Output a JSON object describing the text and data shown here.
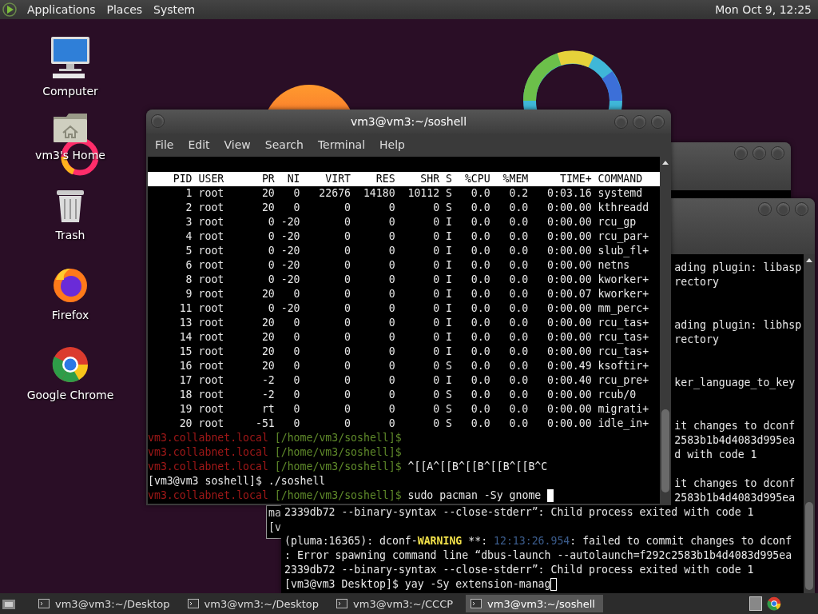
{
  "top_panel": {
    "menus": [
      {
        "label": "Applications"
      },
      {
        "label": "Places"
      },
      {
        "label": "System"
      }
    ],
    "clock": "Mon Oct 9, 12:25"
  },
  "desktop_icons": [
    {
      "kind": "computer",
      "label": "Computer"
    },
    {
      "kind": "home",
      "label": "vm3's Home"
    },
    {
      "kind": "trash",
      "label": "Trash"
    },
    {
      "kind": "firefox",
      "label": "Firefox"
    },
    {
      "kind": "chrome",
      "label": "Google Chrome"
    }
  ],
  "back_window_small": {
    "lines": [
      "ma",
      "[v"
    ]
  },
  "back_terminal": {
    "lines": [
      {
        "kind": "partial",
        "segments": [
          {
            "kind": "text",
            "text": "ading plugin: libasp"
          }
        ]
      },
      {
        "kind": "partial",
        "segments": [
          {
            "kind": "text",
            "text": "rectory"
          }
        ]
      },
      {
        "kind": "blank"
      },
      {
        "kind": "blank"
      },
      {
        "kind": "partial",
        "segments": [
          {
            "kind": "text",
            "text": "ading plugin: libhsp"
          }
        ]
      },
      {
        "kind": "partial",
        "segments": [
          {
            "kind": "text",
            "text": "rectory"
          }
        ]
      },
      {
        "kind": "blank"
      },
      {
        "kind": "blank"
      },
      {
        "kind": "partial",
        "segments": [
          {
            "kind": "text",
            "text": "ker_language_to_key"
          }
        ]
      },
      {
        "kind": "blank"
      },
      {
        "kind": "blank"
      },
      {
        "kind": "partial",
        "segments": [
          {
            "kind": "text",
            "text": "it changes to dconf"
          }
        ]
      },
      {
        "kind": "partial",
        "segments": [
          {
            "kind": "text",
            "text": "2583b1b4d4083d995ea"
          }
        ]
      },
      {
        "kind": "partial",
        "segments": [
          {
            "kind": "text",
            "text": "d with code 1"
          }
        ]
      },
      {
        "kind": "blank"
      },
      {
        "kind": "partial",
        "segments": [
          {
            "kind": "text",
            "text": "it changes to dconf"
          }
        ]
      },
      {
        "kind": "partial",
        "segments": [
          {
            "kind": "text",
            "text": "2583b1b4d4083d995ea"
          }
        ]
      },
      {
        "kind": "full",
        "segments": [
          {
            "kind": "text",
            "text": "2339db72 --binary-syntax --close-stderr”: Child process exited with code 1"
          }
        ]
      },
      {
        "kind": "blank"
      },
      {
        "kind": "full",
        "segments": [
          {
            "kind": "text",
            "text": "(pluma:16365): dconf-"
          },
          {
            "kind": "warning",
            "text": "WARNING"
          },
          {
            "kind": "text",
            "text": " **: "
          },
          {
            "kind": "time",
            "text": "12:13:26.954"
          },
          {
            "kind": "text",
            "text": ": failed to commit changes to dconf"
          }
        ]
      },
      {
        "kind": "full",
        "segments": [
          {
            "kind": "text",
            "text": ": Error spawning command line “dbus-launch --autolaunch=f292c2583b1b4d4083d995ea"
          }
        ]
      },
      {
        "kind": "full",
        "segments": [
          {
            "kind": "text",
            "text": "2339db72 --binary-syntax --close-stderr”: Child process exited with code 1"
          }
        ]
      },
      {
        "kind": "full",
        "segments": [
          {
            "kind": "text",
            "text": "[vm3@vm3 Desktop]$ yay -Sy extension-manag"
          }
        ],
        "cursor": true,
        "focused": false
      }
    ]
  },
  "terminal": {
    "title": "vm3@vm3:~/soshell",
    "menu": [
      {
        "label": "File"
      },
      {
        "label": "Edit"
      },
      {
        "label": "View"
      },
      {
        "label": "Search"
      },
      {
        "label": "Terminal"
      },
      {
        "label": "Help"
      }
    ],
    "top": {
      "columns": [
        "PID",
        "USER",
        "PR",
        "NI",
        "VIRT",
        "RES",
        "SHR",
        "S",
        "%CPU",
        "%MEM",
        "TIME+",
        "COMMAND"
      ],
      "rows": [
        [
          "1",
          "root",
          "20",
          "0",
          "22676",
          "14180",
          "10112",
          "S",
          "0.0",
          "0.2",
          "0:03.16",
          "systemd"
        ],
        [
          "2",
          "root",
          "20",
          "0",
          "0",
          "0",
          "0",
          "S",
          "0.0",
          "0.0",
          "0:00.00",
          "kthreadd"
        ],
        [
          "3",
          "root",
          "0",
          "-20",
          "0",
          "0",
          "0",
          "I",
          "0.0",
          "0.0",
          "0:00.00",
          "rcu_gp"
        ],
        [
          "4",
          "root",
          "0",
          "-20",
          "0",
          "0",
          "0",
          "I",
          "0.0",
          "0.0",
          "0:00.00",
          "rcu_par+"
        ],
        [
          "5",
          "root",
          "0",
          "-20",
          "0",
          "0",
          "0",
          "I",
          "0.0",
          "0.0",
          "0:00.00",
          "slub_fl+"
        ],
        [
          "6",
          "root",
          "0",
          "-20",
          "0",
          "0",
          "0",
          "I",
          "0.0",
          "0.0",
          "0:00.00",
          "netns"
        ],
        [
          "8",
          "root",
          "0",
          "-20",
          "0",
          "0",
          "0",
          "I",
          "0.0",
          "0.0",
          "0:00.00",
          "kworker+"
        ],
        [
          "9",
          "root",
          "20",
          "0",
          "0",
          "0",
          "0",
          "I",
          "0.0",
          "0.0",
          "0:00.07",
          "kworker+"
        ],
        [
          "11",
          "root",
          "0",
          "-20",
          "0",
          "0",
          "0",
          "I",
          "0.0",
          "0.0",
          "0:00.00",
          "mm_perc+"
        ],
        [
          "13",
          "root",
          "20",
          "0",
          "0",
          "0",
          "0",
          "I",
          "0.0",
          "0.0",
          "0:00.00",
          "rcu_tas+"
        ],
        [
          "14",
          "root",
          "20",
          "0",
          "0",
          "0",
          "0",
          "I",
          "0.0",
          "0.0",
          "0:00.00",
          "rcu_tas+"
        ],
        [
          "15",
          "root",
          "20",
          "0",
          "0",
          "0",
          "0",
          "I",
          "0.0",
          "0.0",
          "0:00.00",
          "rcu_tas+"
        ],
        [
          "16",
          "root",
          "20",
          "0",
          "0",
          "0",
          "0",
          "S",
          "0.0",
          "0.0",
          "0:00.49",
          "ksoftir+"
        ],
        [
          "17",
          "root",
          "-2",
          "0",
          "0",
          "0",
          "0",
          "I",
          "0.0",
          "0.0",
          "0:00.40",
          "rcu_pre+"
        ],
        [
          "18",
          "root",
          "-2",
          "0",
          "0",
          "0",
          "0",
          "S",
          "0.0",
          "0.0",
          "0:00.00",
          "rcub/0"
        ],
        [
          "19",
          "root",
          "rt",
          "0",
          "0",
          "0",
          "0",
          "S",
          "0.0",
          "0.0",
          "0:00.00",
          "migrati+"
        ],
        [
          "20",
          "root",
          "-51",
          "0",
          "0",
          "0",
          "0",
          "S",
          "0.0",
          "0.0",
          "0:00.00",
          "idle_in+"
        ]
      ]
    },
    "lines": [
      {
        "segments": [
          {
            "kind": "host",
            "text": "vm3.collabnet.local"
          },
          {
            "kind": "path",
            "text": " [/home/vm3/soshell]$"
          }
        ]
      },
      {
        "segments": [
          {
            "kind": "host",
            "text": "vm3.collabnet.local"
          },
          {
            "kind": "path",
            "text": " [/home/vm3/soshell]$"
          }
        ]
      },
      {
        "segments": [
          {
            "kind": "host",
            "text": "vm3.collabnet.local"
          },
          {
            "kind": "path",
            "text": " [/home/vm3/soshell]$"
          },
          {
            "kind": "text",
            "text": " ^[[A^[[B^[[B^[[B^[[B^C"
          }
        ]
      },
      {
        "segments": [
          {
            "kind": "text",
            "text": "[vm3@vm3 soshell]$ ./soshell"
          }
        ]
      },
      {
        "segments": [
          {
            "kind": "host",
            "text": "vm3.collabnet.local"
          },
          {
            "kind": "path",
            "text": " [/home/vm3/soshell]$"
          },
          {
            "kind": "text",
            "text": " sudo pacman -Sy gnome "
          }
        ],
        "cursor": true,
        "focused": true
      }
    ]
  },
  "taskbar": {
    "tasks": [
      {
        "label": "vm3@vm3:~/Desktop",
        "selected": false
      },
      {
        "label": "vm3@vm3:~/Desktop",
        "selected": false
      },
      {
        "label": "vm3@vm3:~/CCCP",
        "selected": false
      },
      {
        "label": "vm3@vm3:~/soshell",
        "selected": true
      }
    ]
  }
}
